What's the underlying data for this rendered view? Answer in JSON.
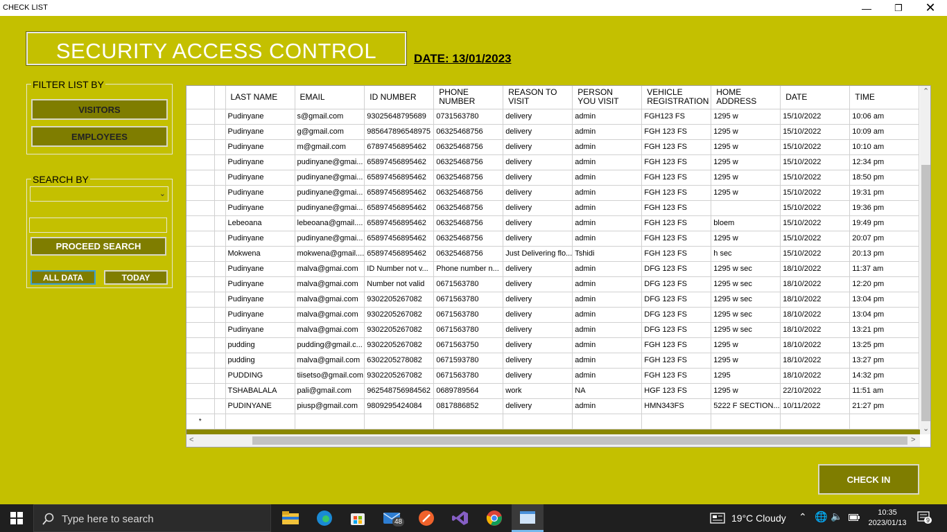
{
  "window": {
    "title": "CHECK LIST"
  },
  "header": {
    "title": "SECURITY ACCESS CONTROL",
    "date": "DATE: 13/01/2023"
  },
  "filter": {
    "legend": "FILTER LIST BY",
    "visitors": "VISITORS",
    "employees": "EMPLOYEES"
  },
  "search": {
    "legend": "SEARCH BY",
    "select_value": "",
    "input_value": "",
    "proceed": "PROCEED SEARCH",
    "all_data": "ALL DATA",
    "today": "TODAY"
  },
  "grid": {
    "columns": [
      "LAST NAME",
      "EMAIL",
      "ID NUMBER",
      "PHONE\nNUMBER",
      "REASON TO\nVISIT",
      "PERSON\nYOU VISIT",
      "VEHICLE\nREGISTRATION",
      "HOME\nADDRESS",
      "DATE",
      "TIME"
    ],
    "rows": [
      [
        "Pudinyane",
        "s@gmail.com",
        "93025648795689",
        "0731563780",
        "delivery",
        "admin",
        "FGH123 FS",
        "1295 w",
        "15/10/2022",
        "10:06 am"
      ],
      [
        "Pudinyane",
        "g@gmail.com",
        "985647896548975",
        "06325468756",
        "delivery",
        "admin",
        "FGH 123 FS",
        "1295 w",
        "15/10/2022",
        "10:09 am"
      ],
      [
        "Pudinyane",
        "m@gmail.com",
        "67897456895462",
        "06325468756",
        "delivery",
        "admin",
        "FGH 123 FS",
        "1295 w",
        "15/10/2022",
        "10:10 am"
      ],
      [
        "Pudinyane",
        "pudinyane@gmai...",
        "65897456895462",
        "06325468756",
        "delivery",
        "admin",
        "FGH 123 FS",
        "1295 w",
        "15/10/2022",
        "12:34 pm"
      ],
      [
        "Pudinyane",
        "pudinyane@gmai...",
        "65897456895462",
        "06325468756",
        "delivery",
        "admin",
        "FGH 123 FS",
        "1295 w",
        "15/10/2022",
        "18:50 pm"
      ],
      [
        "Pudinyane",
        "pudinyane@gmai...",
        "65897456895462",
        "06325468756",
        "delivery",
        "admin",
        "FGH 123 FS",
        "1295 w",
        "15/10/2022",
        "19:31 pm"
      ],
      [
        "Pudinyane",
        "pudinyane@gmai...",
        "65897456895462",
        "06325468756",
        "delivery",
        "admin",
        "FGH 123 FS",
        "",
        "15/10/2022",
        "19:36 pm"
      ],
      [
        "Lebeoana",
        "lebeoana@gmail....",
        "65897456895462",
        "06325468756",
        "delivery",
        "admin",
        "FGH 123 FS",
        "bloem",
        "15/10/2022",
        "19:49 pm"
      ],
      [
        "Pudinyane",
        "pudinyane@gmai...",
        "65897456895462",
        "06325468756",
        "delivery",
        "admin",
        "FGH 123 FS",
        "1295 w",
        "15/10/2022",
        "20:07 pm"
      ],
      [
        "Mokwena",
        "mokwena@gmail....",
        "65897456895462",
        "06325468756",
        "Just Delivering flo...",
        "Tshidi",
        "FGH 123 FS",
        "h sec",
        "15/10/2022",
        "20:13 pm"
      ],
      [
        "Pudinyane",
        "malva@gmai.com",
        "ID Number not v...",
        "Phone number n...",
        "delivery",
        "admin",
        "DFG 123 FS",
        "1295 w sec",
        "18/10/2022",
        "11:37 am"
      ],
      [
        "Pudinyane",
        "malva@gmai.com",
        "Number not valid",
        "0671563780",
        "delivery",
        "admin",
        "DFG 123 FS",
        "1295 w sec",
        "18/10/2022",
        "12:20 pm"
      ],
      [
        "Pudinyane",
        "malva@gmai.com",
        "9302205267082",
        "0671563780",
        "delivery",
        "admin",
        "DFG 123 FS",
        "1295 w sec",
        "18/10/2022",
        "13:04 pm"
      ],
      [
        "Pudinyane",
        "malva@gmai.com",
        "9302205267082",
        "0671563780",
        "delivery",
        "admin",
        "DFG 123 FS",
        "1295 w sec",
        "18/10/2022",
        "13:04 pm"
      ],
      [
        "Pudinyane",
        "malva@gmai.com",
        "9302205267082",
        "0671563780",
        "delivery",
        "admin",
        "DFG 123 FS",
        "1295 w sec",
        "18/10/2022",
        "13:21 pm"
      ],
      [
        "pudding",
        "pudding@gmail.c...",
        "9302205267082",
        "0671563750",
        "delivery",
        "admin",
        "FGH 123 FS",
        "1295 w",
        "18/10/2022",
        "13:25 pm"
      ],
      [
        "pudding",
        "malva@gmail.com",
        "6302205278082",
        "0671593780",
        "delivery",
        "admin",
        "FGH 123 FS",
        "1295 w",
        "18/10/2022",
        "13:27 pm"
      ],
      [
        "PUDDING",
        "tiisetso@gmail.com",
        "9302205267082",
        "0671563780",
        "delivery",
        "admin",
        "FGH 123 FS",
        "1295",
        "18/10/2022",
        "14:32 pm"
      ],
      [
        "TSHABALALA",
        "pali@gmail.com",
        "962548756984562",
        "0689789564",
        "work",
        "NA",
        "HGF 123 FS",
        "1295 w",
        "22/10/2022",
        "11:51 am"
      ],
      [
        "PUDINYANE",
        "piusp@gmail.com",
        "9809295424084",
        "0817886852",
        "delivery",
        "admin",
        "HMN343FS",
        "5222 F SECTION...",
        "10/11/2022",
        "21:27 pm"
      ]
    ],
    "new_row_marker": "*"
  },
  "actions": {
    "check_in": "CHECK IN"
  },
  "taskbar": {
    "search_placeholder": "Type here to search",
    "mail_badge": "48",
    "weather": "19°C  Cloudy",
    "time": "10:35",
    "date": "2023/01/13",
    "notification_count": "9"
  },
  "colors": {
    "background": "#c4c000",
    "button": "#7f7d00",
    "grid_strip": "#8a8700"
  }
}
